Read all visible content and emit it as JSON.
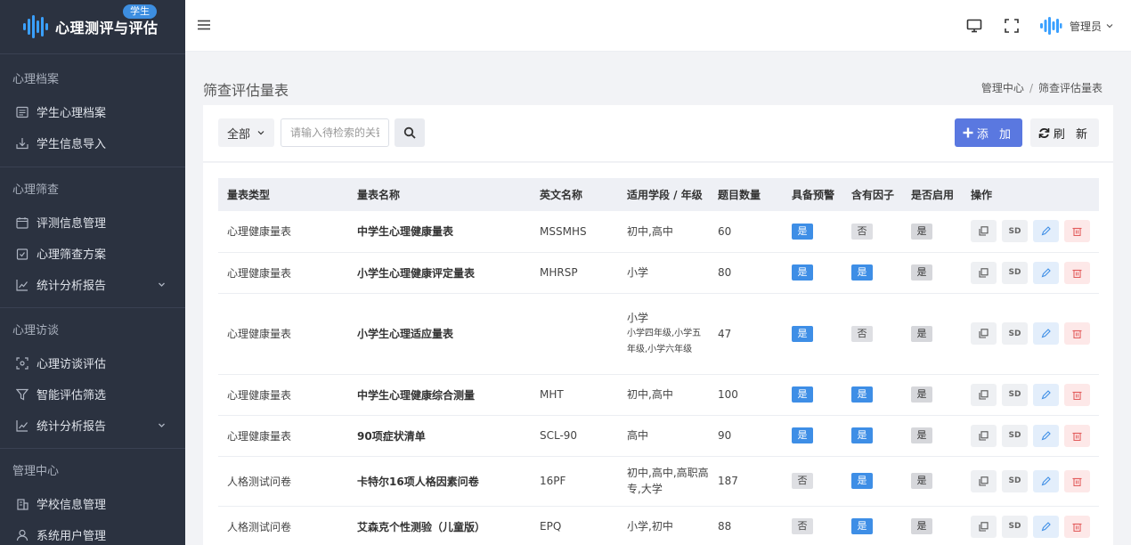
{
  "brand": {
    "title": "心理测评与评估",
    "badge": "学生"
  },
  "sidebar": {
    "groups": [
      {
        "title": "心理档案",
        "items": [
          {
            "label": "学生心理档案"
          },
          {
            "label": "学生信息导入"
          }
        ]
      },
      {
        "title": "心理筛查",
        "items": [
          {
            "label": "评测信息管理"
          },
          {
            "label": "心理筛查方案"
          },
          {
            "label": "统计分析报告"
          }
        ]
      },
      {
        "title": "心理访谈",
        "items": [
          {
            "label": "心理访谈评估"
          },
          {
            "label": "智能评估筛选"
          },
          {
            "label": "统计分析报告"
          }
        ]
      },
      {
        "title": "管理中心",
        "items": [
          {
            "label": "学校信息管理"
          },
          {
            "label": "系统用户管理"
          }
        ]
      }
    ]
  },
  "topbar": {
    "user": "管理员"
  },
  "page": {
    "title": "筛查评估量表"
  },
  "breadcrumb": {
    "root": "管理中心",
    "sep": "/",
    "current": "筛查评估量表"
  },
  "toolbar": {
    "scope": "全部",
    "search_placeholder": "请输入待检索的关键字",
    "add_label": "添 加",
    "refresh_label": "刷 新"
  },
  "table": {
    "headers": [
      "量表类型",
      "量表名称",
      "英文名称",
      "适用学段 / 年级",
      "题目数量",
      "具备预警",
      "含有因子",
      "是否启用",
      "操作"
    ],
    "rows": [
      {
        "type": "心理健康量表",
        "name": "中学生心理健康量表",
        "en": "MSSMHS",
        "stage": "初中,高中",
        "count": "60",
        "warn": "是",
        "factor": "否",
        "enabled": "是"
      },
      {
        "type": "心理健康量表",
        "name": "小学生心理健康评定量表",
        "en": "MHRSP",
        "stage": "小学",
        "count": "80",
        "warn": "是",
        "factor": "是",
        "enabled": "是"
      },
      {
        "type": "心理健康量表",
        "name": "小学生心理适应量表",
        "en": "",
        "stage": "小学",
        "stage_sub": "小学四年级,小学五年级,小学六年级",
        "count": "47",
        "warn": "是",
        "factor": "否",
        "enabled": "是"
      },
      {
        "type": "心理健康量表",
        "name": "中学生心理健康综合测量",
        "en": "MHT",
        "stage": "初中,高中",
        "count": "100",
        "warn": "是",
        "factor": "是",
        "enabled": "是"
      },
      {
        "type": "心理健康量表",
        "name": "90项症状清单",
        "en": "SCL-90",
        "stage": "高中",
        "count": "90",
        "warn": "是",
        "factor": "是",
        "enabled": "是"
      },
      {
        "type": "人格测试问卷",
        "name": "卡特尔16项人格因素问卷",
        "en": "16PF",
        "stage": "初中,高中,高职高专,大学",
        "count": "187",
        "warn": "否",
        "factor": "是",
        "enabled": "是"
      },
      {
        "type": "人格测试问卷",
        "name": "艾森克个性测验（儿童版）",
        "en": "EPQ",
        "stage": "小学,初中",
        "count": "88",
        "warn": "否",
        "factor": "是",
        "enabled": "是"
      }
    ],
    "op_sd": "SD"
  },
  "colors": {
    "sidebar_bg": "#2b3240",
    "primary": "#5a78e0",
    "tag_yes": "#3e8ee6"
  }
}
